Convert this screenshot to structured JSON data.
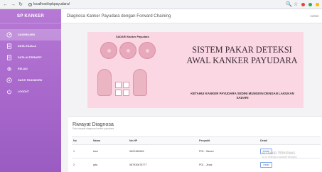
{
  "browser": {
    "url": "localhost/spkpayudara/",
    "back_glyph": "←",
    "forward_glyph": "→",
    "reload_glyph": "↻",
    "info_glyph": "i",
    "zoom_glyph": "🔍",
    "star_glyph": "☆"
  },
  "sidebar": {
    "brand": "SP KANKER",
    "items": [
      {
        "label": "DASHBOARD",
        "icon": "dashboard-icon"
      },
      {
        "label": "DATA GEJALA",
        "icon": "document-icon"
      },
      {
        "label": "DATA ALTERNATIF",
        "icon": "document-icon"
      },
      {
        "label": "RELASI",
        "icon": "gear-icon"
      },
      {
        "label": "GANTI PASSWORD",
        "icon": "key-icon"
      },
      {
        "label": "LOGOUT",
        "icon": "power-icon"
      }
    ]
  },
  "header": {
    "title": "Diagnosa Kanker Payudara dengan Forward Chaining",
    "user": "Admin"
  },
  "banner": {
    "small_title": "SADARI Kanker Payudara",
    "headline_line1": "SISTEM PAKAR DETEKSI",
    "headline_line2": "AWAL KANKER PAYUDARA",
    "subline": "KETAHUI KANKER PAYUDARA SEDINI MUNGKIN DENGAN LAKUKAN SADARI"
  },
  "history": {
    "title": "Riwayat Diagnosa",
    "subtitle": "Data riwayat diagnosa kanker payudara",
    "columns": [
      "No",
      "Nama",
      "No.HP",
      "Penyakit",
      "Detail"
    ],
    "rows": [
      {
        "no": "1",
        "nama": "kian",
        "hp": "0822465566",
        "penyakit": "P02 - Sanan",
        "detail": "Detail"
      },
      {
        "no": "2",
        "nama": "gita",
        "hp": "087930678777",
        "penyakit": "P01 - Jinak",
        "detail": "Detail"
      }
    ]
  },
  "watermark": {
    "title": "Activate Windows",
    "subtitle": "Go to Settings to activate Windows."
  },
  "colors": {
    "sidebar_top": "#b679d4",
    "sidebar_bottom": "#9a5cc2",
    "banner_bg": "#fbd7e3",
    "detail_button": "#3b6fd0"
  }
}
